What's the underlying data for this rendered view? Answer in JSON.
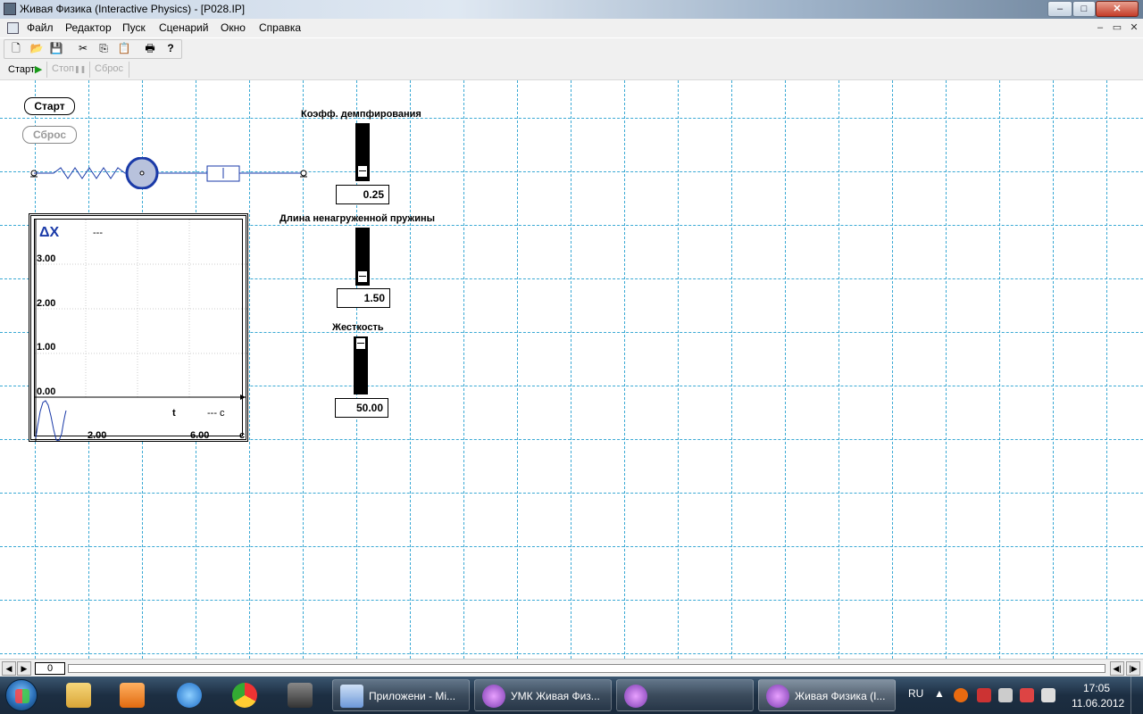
{
  "window": {
    "title": "Живая Физика (Interactive Physics) - [P028.IP]",
    "minimize": "–",
    "maximize": "□",
    "close": "✕"
  },
  "menu": {
    "items": [
      "Файл",
      "Редактор",
      "Пуск",
      "Сценарий",
      "Окно",
      "Справка"
    ],
    "mdi_min": "–",
    "mdi_restore": "▭",
    "mdi_close": "✕"
  },
  "toolbar": {
    "icons": [
      "new-icon",
      "open-icon",
      "save-icon",
      "cut-icon",
      "copy-icon",
      "paste-icon",
      "print-icon",
      "help-icon"
    ],
    "glyphs": [
      "🗋",
      "📂",
      "💾",
      "✂",
      "⎘",
      "📋",
      "🖶",
      "?"
    ]
  },
  "runbar": {
    "start": "Старт",
    "start_glyph": "▶",
    "stop": "Стоп",
    "stop_glyph": "❚❚",
    "reset": "Сброс"
  },
  "scene": {
    "start_button": "Старт",
    "reset_button": "Сброс",
    "sliders": [
      {
        "label": "Коэфф. демпфирования",
        "value": "0.25",
        "level": 0.1
      },
      {
        "label": "Длина ненагруженной пружины",
        "value": "1.50",
        "level": 0.1
      },
      {
        "label": "Жесткость",
        "value": "50.00",
        "level": 1.0
      }
    ]
  },
  "graph": {
    "y_label": "ΔX",
    "y_readout": "---",
    "y_ticks": [
      "3.00",
      "2.00",
      "1.00",
      "0.00"
    ],
    "x_label": "t",
    "x_readout": "--- c",
    "x_ticks": [
      "2.00",
      "6.00"
    ],
    "x_unit": "c"
  },
  "scrollbar": {
    "frame": "0",
    "left_glyph": "◀",
    "right_glyph": "▶",
    "start_glyph": "◀|",
    "end_glyph": "|▶"
  },
  "taskbar": {
    "tasks": [
      {
        "label": "Приложени - Mi..."
      },
      {
        "label": "УМК Живая Физ..."
      },
      {
        "label": ""
      },
      {
        "label": "Живая Физика (I..."
      }
    ],
    "lang": "RU",
    "time": "17:05",
    "date": "11.06.2012"
  },
  "colors": {
    "grid": "#3aa9d4",
    "mass_fill": "#b8c2dc",
    "mass_stroke": "#1a3aa8",
    "spring": "#1a3aa8",
    "graph_label": "#1a3aa8"
  }
}
